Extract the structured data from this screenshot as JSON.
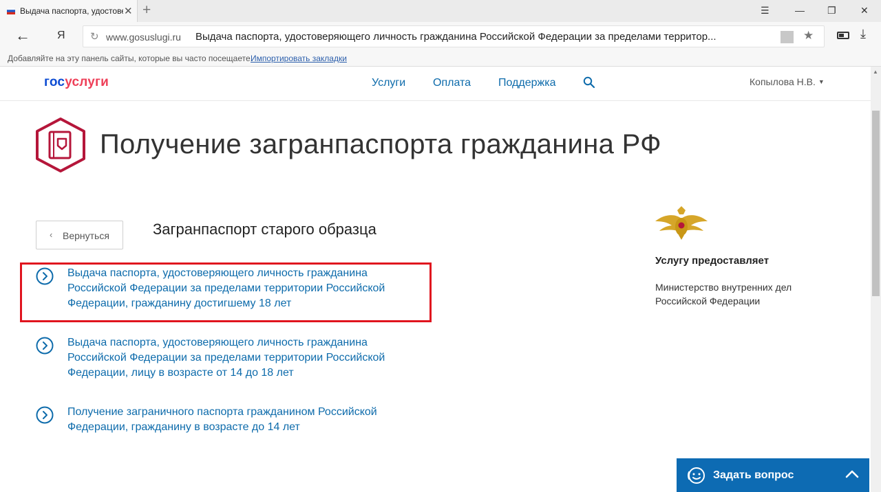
{
  "browser": {
    "tab_title": "Выдача паспорта, удостоверяющего личность гражданина",
    "address_domain": "www.gosuslugi.ru",
    "address_title": "Выдача паспорта, удостоверяющего личность гражданина Российской Федерации за пределами территор...",
    "bookmarks_hint": "Добавляйте на эту панель сайты, которые вы часто посещаете.",
    "bookmarks_import": "Импортировать закладки",
    "yandex_glyph": "Я"
  },
  "header": {
    "logo_part1": "гос",
    "logo_part2": "услуги",
    "nav": [
      "Услуги",
      "Оплата",
      "Поддержка"
    ],
    "user_name": "Копылова Н.В."
  },
  "page": {
    "title": "Получение загранпаспорта гражданина РФ",
    "back_label": "Вернуться",
    "section_title": "Загранпаспорт старого образца",
    "services": [
      "Выдача паспорта, удостоверяющего личность гражданина Российской Федерации за пределами территории Российской Федерации, гражданину достигшему 18 лет",
      "Выдача паспорта, удостоверяющего личность гражданина Российской Федерации за пределами территории Российской Федерации, лицу в возрасте от 14 до 18 лет",
      "Получение заграничного паспорта гражданином Российской Федерации, гражданину в возрасте до 14 лет"
    ]
  },
  "sidebar": {
    "provider_label": "Услугу предоставляет",
    "provider_name": "Министерство внутренних дел Российской Федерации"
  },
  "chat": {
    "label": "Задать вопрос"
  },
  "colors": {
    "link": "#0d6bab",
    "brand_blue": "#0d4cd3",
    "brand_red": "#ee3f58",
    "highlight": "#e0141e",
    "chat_bg": "#0d6bb3"
  }
}
